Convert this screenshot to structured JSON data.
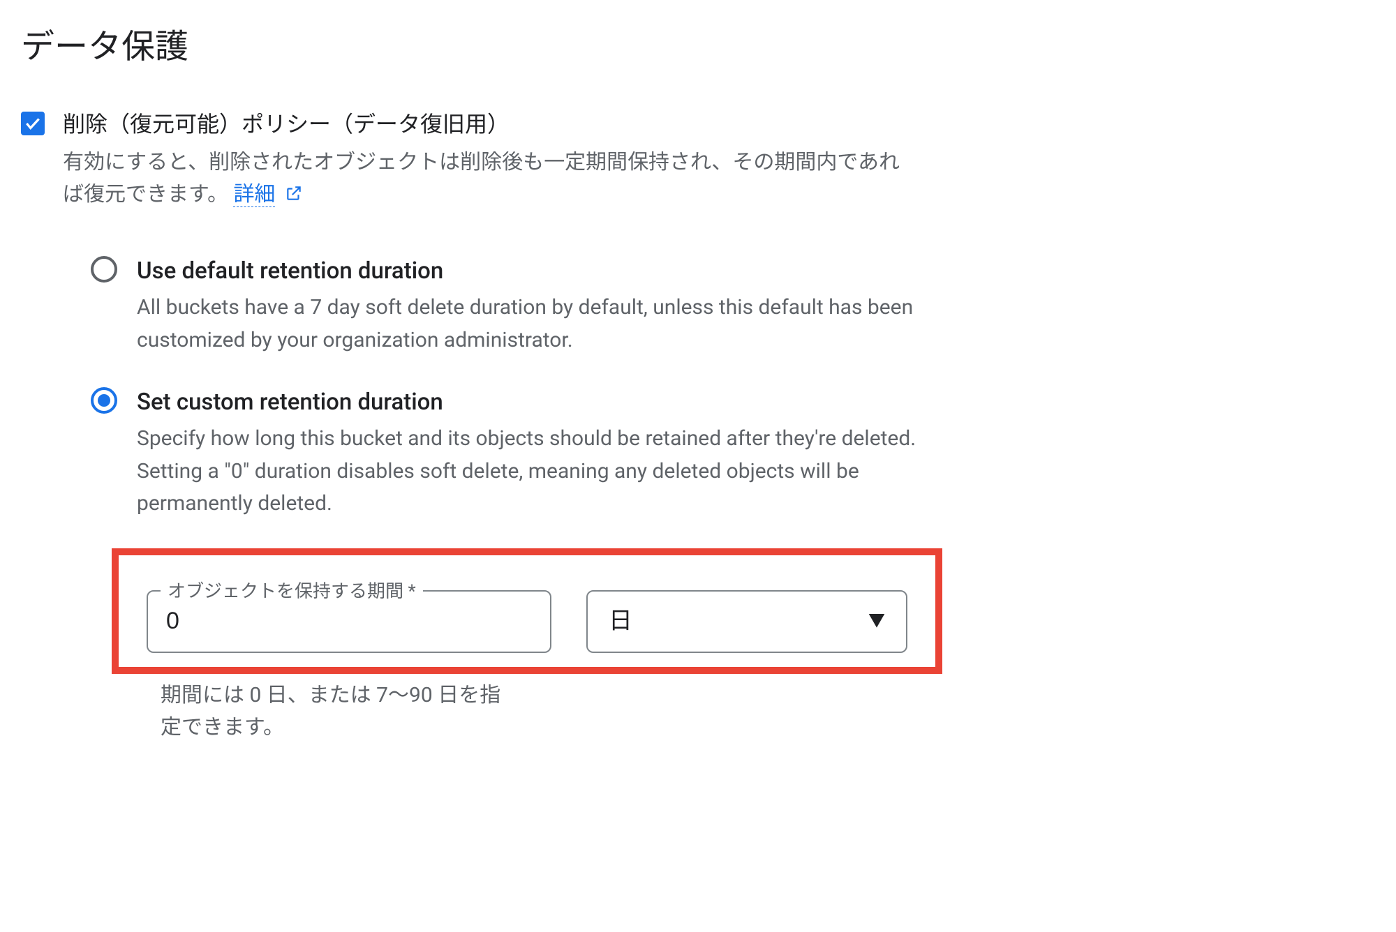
{
  "section_title": "データ保護",
  "soft_delete": {
    "checked": true,
    "label": "削除（復元可能）ポリシー（データ復旧用）",
    "description_before_link": "有効にすると、削除されたオブジェクトは削除後も一定期間保持され、その期間内であれば復元できます。",
    "learn_more_label": "詳細"
  },
  "radios": {
    "default": {
      "selected": false,
      "label": "Use default retention duration",
      "desc": "All buckets have a 7 day soft delete duration by default, unless this default has been customized by your organization administrator."
    },
    "custom": {
      "selected": true,
      "label": "Set custom retention duration",
      "desc": "Specify how long this bucket and its objects should be retained after they're deleted. Setting a \"0\" duration disables soft delete, meaning any deleted objects will be permanently deleted."
    }
  },
  "duration": {
    "field_label": "オブジェクトを保持する期間 *",
    "value": "0",
    "unit": "日",
    "hint": "期間には 0 日、または 7～90 日を指定できます。"
  }
}
